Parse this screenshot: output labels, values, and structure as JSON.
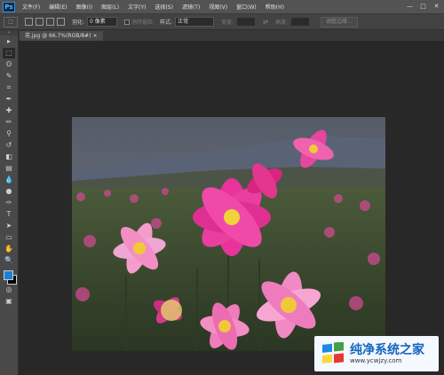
{
  "app": {
    "logo": "Ps"
  },
  "menu": [
    "文件(F)",
    "编辑(E)",
    "图像(I)",
    "图层(L)",
    "文字(Y)",
    "选择(S)",
    "滤镜(T)",
    "视图(V)",
    "窗口(W)",
    "帮助(H)"
  ],
  "window_controls": [
    "—",
    "□",
    "✕"
  ],
  "options": {
    "feather_label": "羽化:",
    "feather_value": "0 像素",
    "antialias_label": "消除锯齿",
    "style_label": "样式:",
    "style_value": "正常",
    "width_label": "宽度:",
    "height_label": "高度:",
    "refine_label": "调整边缘..."
  },
  "document": {
    "tab_title": "花.jpg @ 66.7%(RGB/8#)",
    "close_glyph": "×"
  },
  "tools": [
    "move-icon",
    "marquee-icon",
    "lasso-icon",
    "quick-select-icon",
    "crop-icon",
    "eyedropper-icon",
    "spot-heal-icon",
    "brush-icon",
    "clone-stamp-icon",
    "history-brush-icon",
    "eraser-icon",
    "gradient-icon",
    "blur-icon",
    "dodge-icon",
    "pen-icon",
    "type-icon",
    "path-select-icon",
    "rectangle-icon",
    "hand-icon",
    "zoom-icon"
  ],
  "tool_glyphs": [
    "▸",
    "⬚",
    "ʘ",
    "✎",
    "⌗",
    "✒",
    "✚",
    "✏",
    "⚲",
    "↺",
    "◧",
    "▤",
    "💧",
    "●",
    "✑",
    "T",
    "➤",
    "▭",
    "✋",
    "🔍"
  ],
  "colors": {
    "foreground": "#1b80d8",
    "background": "#000000",
    "accent": "#2f8ee0"
  },
  "watermark": {
    "title": "纯净系统之家",
    "url": "www.ycwjzy.com"
  }
}
